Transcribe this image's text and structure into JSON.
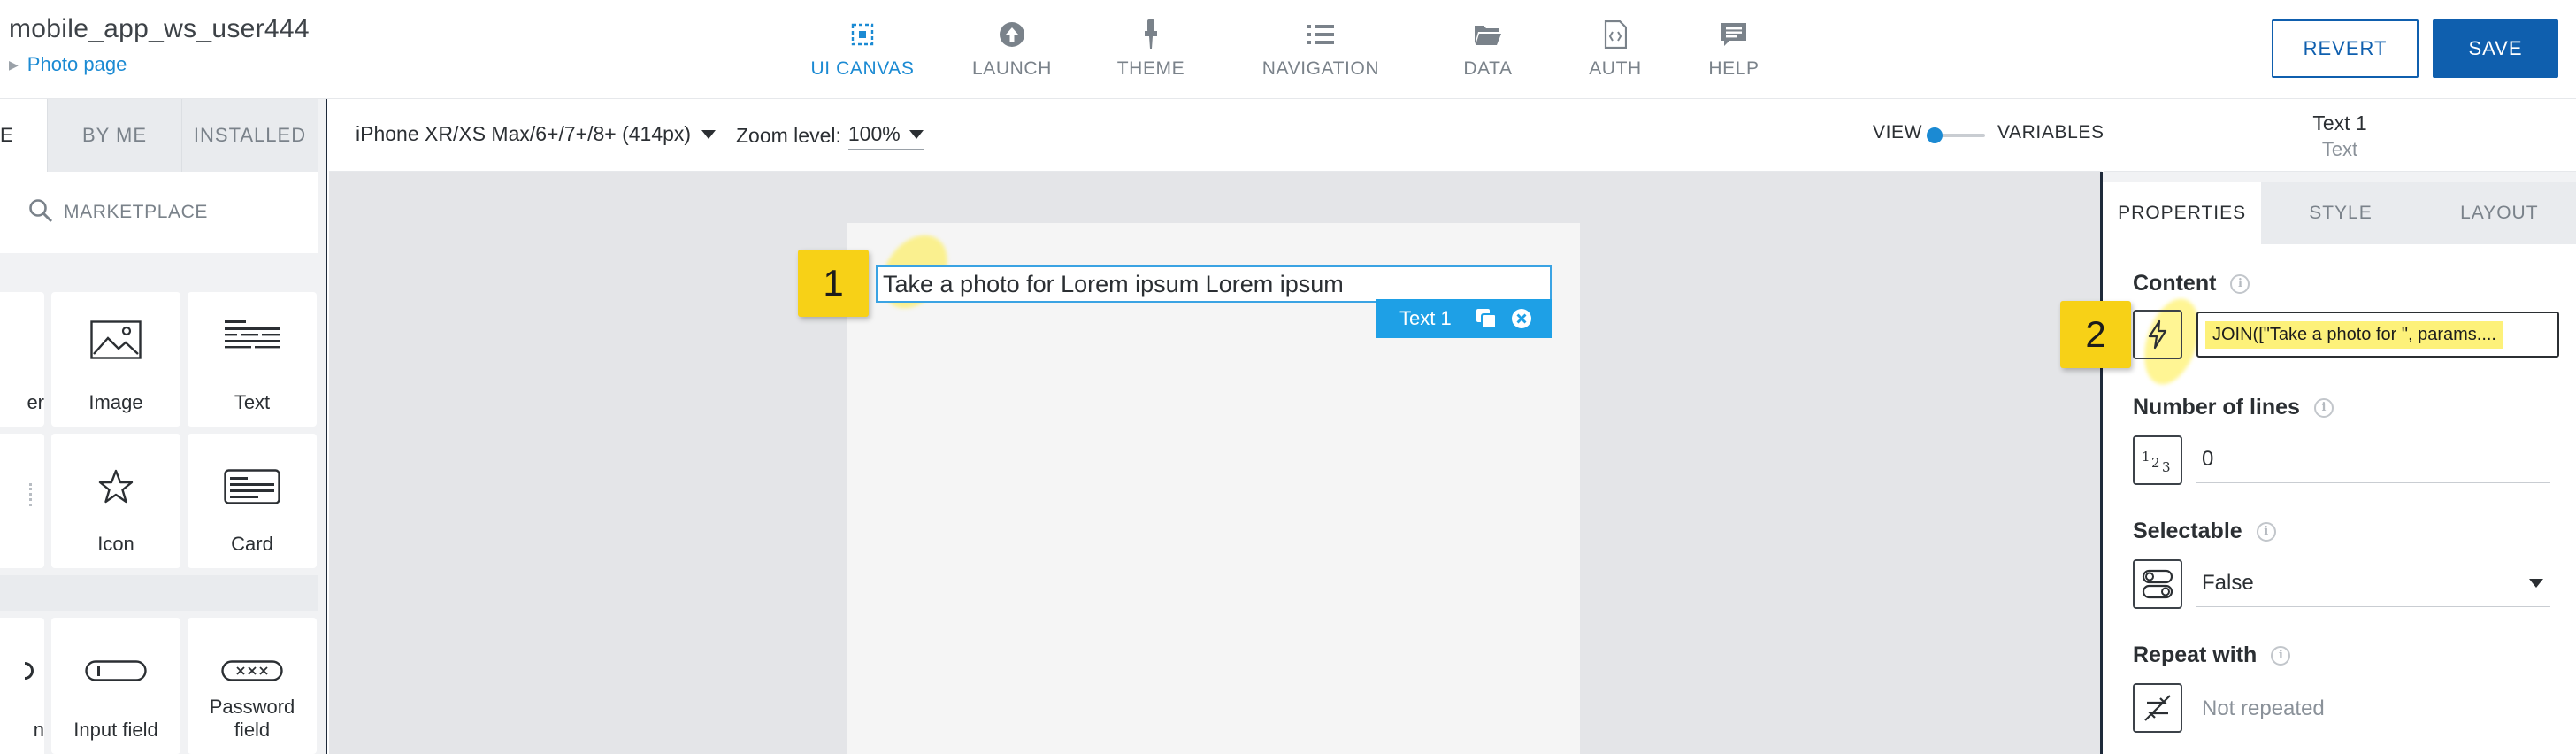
{
  "header": {
    "app_name": "mobile_app_ws_user444",
    "breadcrumb": "Photo page",
    "tabs": [
      {
        "label": "UI CANVAS",
        "icon": "ui-canvas-icon",
        "active": true
      },
      {
        "label": "LAUNCH",
        "icon": "launch-icon"
      },
      {
        "label": "THEME",
        "icon": "theme-icon"
      },
      {
        "label": "NAVIGATION",
        "icon": "navigation-icon"
      },
      {
        "label": "DATA",
        "icon": "data-icon"
      },
      {
        "label": "AUTH",
        "icon": "auth-icon"
      },
      {
        "label": "HELP",
        "icon": "help-icon"
      }
    ],
    "revert_label": "REVERT",
    "save_label": "SAVE",
    "accent": "#1b8ad3",
    "primary": "#0f5fae"
  },
  "left_panel": {
    "tabs": [
      "E",
      "BY ME",
      "INSTALLED"
    ],
    "search_placeholder": "MARKETPLACE",
    "components": [
      {
        "label": "er",
        "icon": "container-icon"
      },
      {
        "label": "Image",
        "icon": "image-icon"
      },
      {
        "label": "Text",
        "icon": "text-icon"
      },
      {
        "label": "Icon",
        "icon": "star-icon"
      },
      {
        "label": "Card",
        "icon": "card-icon"
      },
      {
        "label": "n",
        "icon": "button-icon"
      },
      {
        "label": "Input field",
        "icon": "input-field-icon"
      },
      {
        "label": "Password field",
        "icon": "password-field-icon"
      }
    ]
  },
  "canvas_toolbar": {
    "device": "iPhone XR/XS Max/6+/7+/8+ (414px)",
    "zoom_label": "Zoom level:",
    "zoom_value": "100%",
    "view_label": "VIEW",
    "variables_label": "VARIABLES"
  },
  "canvas": {
    "selected_text": "Take a photo for Lorem ipsum Lorem ipsum",
    "selected_label": "Text 1",
    "step1": "1",
    "step2": "2",
    "highlight_color": "#f7d117"
  },
  "component_header": {
    "title": "Text 1",
    "type": "Text"
  },
  "right_panel": {
    "tabs": [
      "PROPERTIES",
      "STYLE",
      "LAYOUT"
    ],
    "content_label": "Content",
    "content_value": "JOIN([\"Take a photo for \", params....",
    "lines_label": "Number of lines",
    "lines_value": "0",
    "selectable_label": "Selectable",
    "selectable_value": "False",
    "repeat_label": "Repeat with",
    "repeat_value": "Not repeated"
  }
}
